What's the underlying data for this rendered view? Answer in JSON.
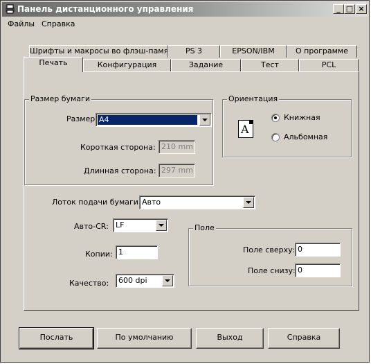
{
  "window": {
    "title": "Панель дистанционного управления"
  },
  "menu": [
    "Файлы",
    "Справка"
  ],
  "tabs_back": [
    "Шрифты и макросы во флэш-памяти",
    "PS 3",
    "EPSON/IBM",
    "О программе"
  ],
  "tabs_front": [
    "Печать",
    "Конфигурация",
    "Задание",
    "Тест",
    "PCL"
  ],
  "paper": {
    "legend": "Размер бумаги",
    "size_label": "Размер:",
    "size_value": "A4",
    "short_label": "Короткая сторона:",
    "short_value": "210 mm",
    "long_label": "Длинная сторона:",
    "long_value": "297 mm"
  },
  "orientation": {
    "legend": "Ориентация",
    "icon_letter": "A",
    "portrait": "Книжная",
    "landscape": "Альбомная",
    "selected": "portrait"
  },
  "tray": {
    "label": "Лоток подачи бумаги:",
    "value": "Авто"
  },
  "autocr": {
    "label": "Авто-CR:",
    "value": "LF"
  },
  "copies": {
    "label": "Копии:",
    "value": "1"
  },
  "quality": {
    "label": "Качество:",
    "value": "600 dpi"
  },
  "margins": {
    "legend": "Поле",
    "top_label": "Поле сверху:",
    "top_value": "0",
    "bottom_label": "Поле снизу:",
    "bottom_value": "0"
  },
  "buttons": {
    "send": "Послать",
    "default": "По умолчанию",
    "exit": "Выход",
    "help": "Справка"
  },
  "window_controls": {
    "minimize": "_",
    "maximize": "□",
    "close": "×"
  }
}
